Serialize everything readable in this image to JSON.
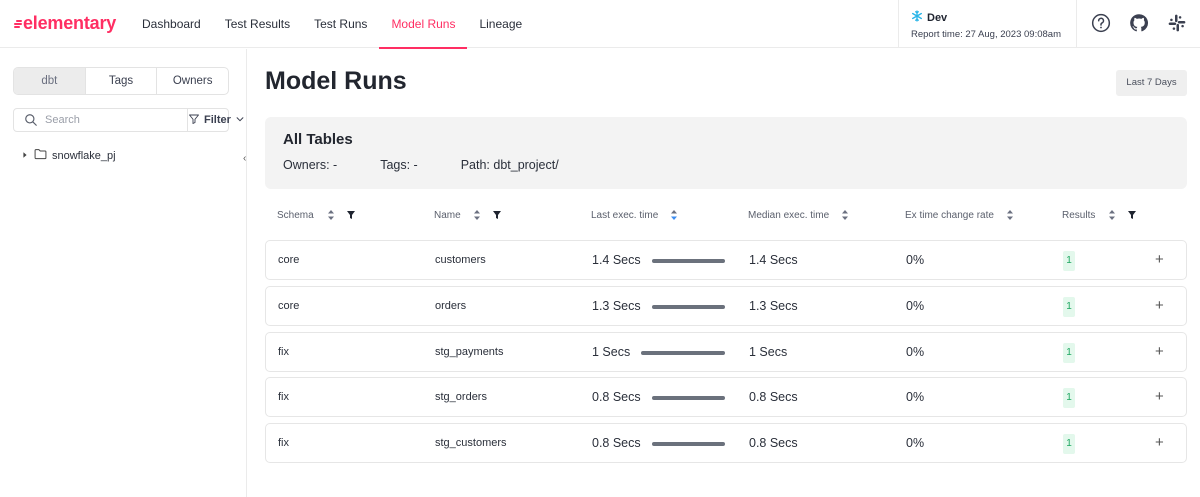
{
  "brand": {
    "name": "elementary",
    "color": "#ff2e63"
  },
  "nav": {
    "items": [
      {
        "label": "Dashboard",
        "active": false
      },
      {
        "label": "Test Results",
        "active": false
      },
      {
        "label": "Test Runs",
        "active": false
      },
      {
        "label": "Model Runs",
        "active": true
      },
      {
        "label": "Lineage",
        "active": false
      }
    ]
  },
  "env": {
    "name": "Dev",
    "report_time": "Report time: 27 Aug, 2023 09:08am",
    "icon": "snowflake-icon"
  },
  "top_icons": [
    "help-icon",
    "github-icon",
    "slack-icon"
  ],
  "sidebar": {
    "tabs": [
      {
        "label": "dbt",
        "active": true
      },
      {
        "label": "Tags",
        "active": false
      },
      {
        "label": "Owners",
        "active": false
      }
    ],
    "search_placeholder": "Search",
    "filter_label": "Filter",
    "tree": [
      {
        "label": "snowflake_pj"
      }
    ],
    "collapse_glyph": "‹"
  },
  "main": {
    "title": "Model Runs",
    "range_label": "Last 7 Days",
    "summary": {
      "title": "All Tables",
      "owners": "Owners: -",
      "tags": "Tags: -",
      "path": "Path: dbt_project/"
    },
    "columns": [
      {
        "label": "Schema"
      },
      {
        "label": "Name"
      },
      {
        "label": "Last exec. time"
      },
      {
        "label": "Median exec. time"
      },
      {
        "label": "Ex time change rate"
      },
      {
        "label": "Results"
      }
    ],
    "rows": [
      {
        "schema": "core",
        "name": "customers",
        "last": "1.4 Secs",
        "last_value": 1.4,
        "median": "1.4 Secs",
        "rate": "0%",
        "results": "1"
      },
      {
        "schema": "core",
        "name": "orders",
        "last": "1.3 Secs",
        "last_value": 1.3,
        "median": "1.3 Secs",
        "rate": "0%",
        "results": "1"
      },
      {
        "schema": "fix",
        "name": "stg_payments",
        "last": "1 Secs",
        "last_value": 1.0,
        "median": "1 Secs",
        "rate": "0%",
        "results": "1"
      },
      {
        "schema": "fix",
        "name": "stg_orders",
        "last": "0.8 Secs",
        "last_value": 0.8,
        "median": "0.8 Secs",
        "rate": "0%",
        "results": "1"
      },
      {
        "schema": "fix",
        "name": "stg_customers",
        "last": "0.8 Secs",
        "last_value": 0.8,
        "median": "0.8 Secs",
        "rate": "0%",
        "results": "1"
      }
    ],
    "expand_glyph": "+"
  }
}
